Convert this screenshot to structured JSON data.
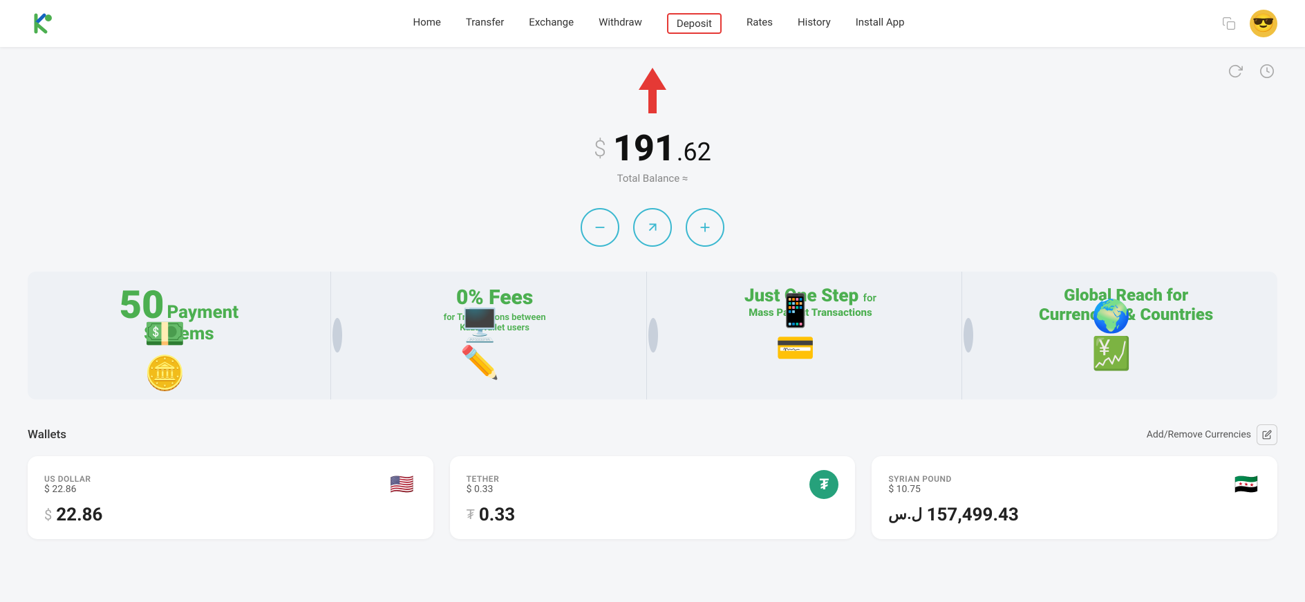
{
  "app": {
    "title": "KazaWallet"
  },
  "nav": {
    "links": [
      {
        "id": "home",
        "label": "Home",
        "active": false
      },
      {
        "id": "transfer",
        "label": "Transfer",
        "active": false
      },
      {
        "id": "exchange",
        "label": "Exchange",
        "active": false
      },
      {
        "id": "withdraw",
        "label": "Withdraw",
        "active": false
      },
      {
        "id": "deposit",
        "label": "Deposit",
        "active": true
      },
      {
        "id": "rates",
        "label": "Rates",
        "active": false
      },
      {
        "id": "history",
        "label": "History",
        "active": false
      },
      {
        "id": "install_app",
        "label": "Install App",
        "active": false
      }
    ]
  },
  "balance": {
    "dollar_sign": "$",
    "main": "191",
    "cents": ".62",
    "label": "Total Balance ≈"
  },
  "actions": [
    {
      "id": "withdraw",
      "type": "withdraw",
      "label": "Withdraw"
    },
    {
      "id": "deposit",
      "type": "deposit",
      "label": "Deposit"
    },
    {
      "id": "transfer",
      "type": "transfer",
      "label": "Transfer"
    }
  ],
  "promo": [
    {
      "id": "payment-systems",
      "big": "50",
      "title": "Payment\nSystems"
    },
    {
      "id": "zero-fees",
      "title": "0% Fees",
      "subtitle": "for Transactions between\nKazaWallet users"
    },
    {
      "id": "one-step",
      "title": "Just One Step",
      "subtitle_prefix": "for",
      "subtitle": "Mass Payout Transactions"
    },
    {
      "id": "global-reach",
      "title": "Global Reach for\nCurrencies & Countries"
    }
  ],
  "wallets": {
    "title": "Wallets",
    "add_remove_label": "Add/Remove Currencies",
    "items": [
      {
        "id": "usd",
        "name": "US DOLLAR",
        "usd_value": "$ 22.86",
        "main_symbol": "$",
        "main_amount": "22.86",
        "flag": "🇺🇸",
        "flag_type": "emoji"
      },
      {
        "id": "usdt",
        "name": "TETHER",
        "usd_value": "$ 0.33",
        "main_symbol": "₮",
        "main_amount": "0.33",
        "flag_type": "tether"
      },
      {
        "id": "syp",
        "name": "SYRIAN POUND",
        "usd_value": "$ 10.75",
        "main_symbol": "ل.س",
        "main_amount": "157,499.43",
        "flag": "🇸🇾",
        "flag_type": "emoji"
      }
    ]
  }
}
